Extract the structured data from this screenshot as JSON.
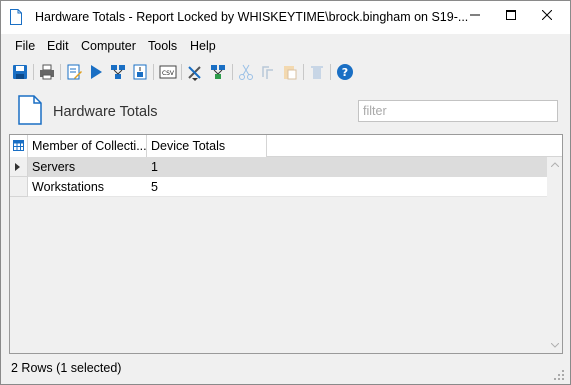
{
  "window": {
    "title": "Hardware Totals - Report Locked by WHISKEYTIME\\brock.bingham on S19-..."
  },
  "menu": {
    "items": [
      "File",
      "Edit",
      "Computer",
      "Tools",
      "Help"
    ]
  },
  "toolbar": {
    "icons": [
      "save-icon",
      "print-icon",
      "edit-report-icon",
      "run-icon",
      "scan-icon",
      "export-icon",
      "export-csv-icon",
      "tools-icon",
      "network-icon",
      "cut-icon",
      "copy-icon",
      "paste-icon",
      "delete-icon",
      "help-icon"
    ],
    "csv_label": "CSV"
  },
  "report": {
    "title": "Hardware Totals",
    "filter_placeholder": "filter",
    "filter_value": ""
  },
  "grid": {
    "columns": [
      "Member of Collecti...",
      "Device Totals"
    ],
    "rows": [
      {
        "member": "Servers",
        "total": "1",
        "selected": true
      },
      {
        "member": "Workstations",
        "total": "5",
        "selected": false
      }
    ]
  },
  "status": {
    "text": "2 Rows (1 selected)"
  },
  "colors": {
    "accent_blue": "#1a6fc4",
    "selection_gray": "#dcdcdc",
    "window_bg": "#f0f0f0"
  }
}
